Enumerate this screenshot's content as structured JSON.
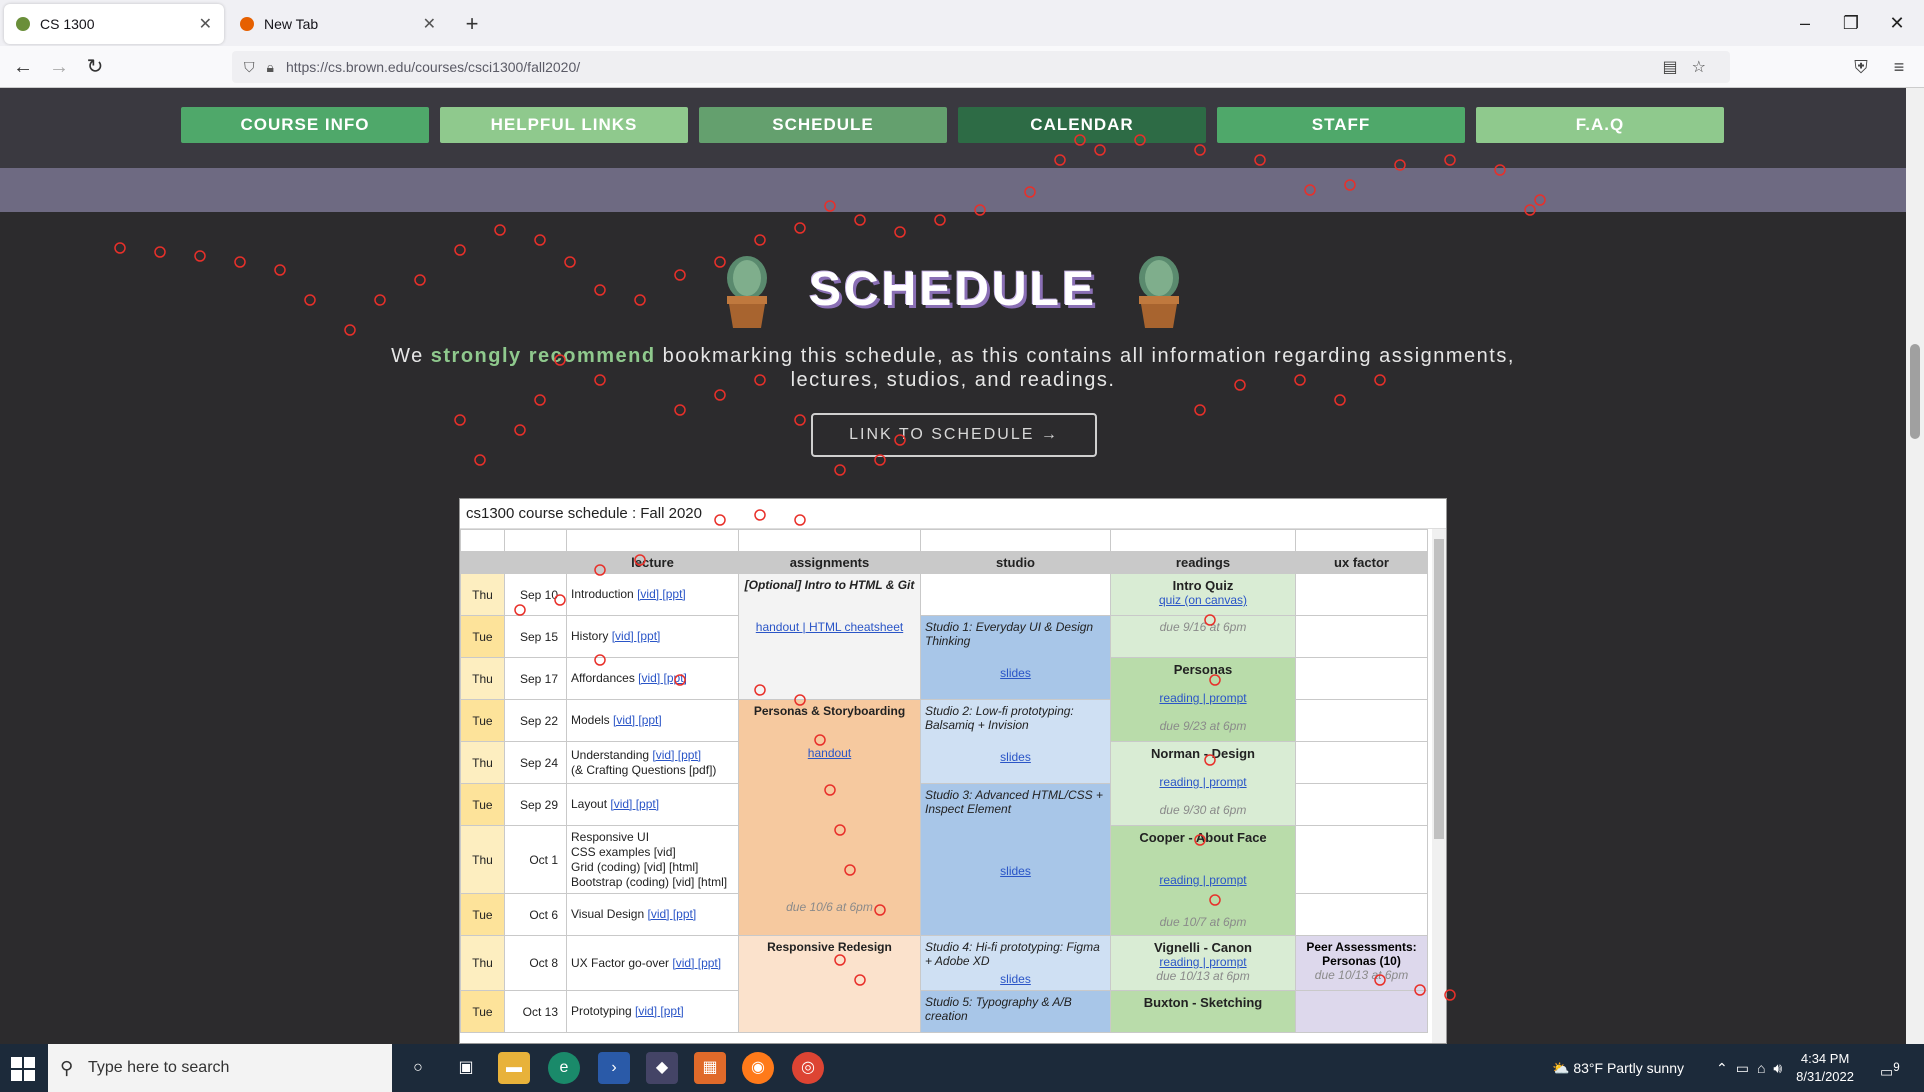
{
  "browser": {
    "tabs": [
      {
        "title": "CS 1300",
        "active": true
      },
      {
        "title": "New Tab",
        "active": false
      }
    ],
    "url": "https://cs.brown.edu/courses/csci1300/fall2020/"
  },
  "site": {
    "nav": [
      "COURSE INFO",
      "HELPFUL LINKS",
      "SCHEDULE",
      "CALENDAR",
      "STAFF",
      "F.A.Q"
    ],
    "nav_colors": [
      "#4fa86a",
      "#8fc98d",
      "#64a06e",
      "#2d6b45",
      "#4fa86a",
      "#8fc98d"
    ],
    "heading": "SCHEDULE",
    "intro_pre": "We ",
    "intro_highlight": "strongly recommend",
    "intro_post": " bookmarking this schedule, as this contains all information regarding assignments, lectures, studios, and readings.",
    "link_button": "LINK TO SCHEDULE →"
  },
  "sheet": {
    "title": "cs1300 course schedule : Fall 2020",
    "headers": [
      "lecture",
      "assignments",
      "studio",
      "readings",
      "ux factor"
    ],
    "rows": [
      {
        "day": "Thu",
        "date": "Sep 10",
        "lecture": "Introduction",
        "links": "[vid] [ppt]"
      },
      {
        "day": "Tue",
        "date": "Sep 15",
        "lecture": "History",
        "links": "[vid] [ppt]"
      },
      {
        "day": "Thu",
        "date": "Sep 17",
        "lecture": "Affordances",
        "links": "[vid] [ppt]"
      },
      {
        "day": "Tue",
        "date": "Sep 22",
        "lecture": "Models",
        "links": "[vid] [ppt]"
      },
      {
        "day": "Thu",
        "date": "Sep 24",
        "lecture": "Understanding",
        "links": "[vid] [ppt]",
        "extra": "(& Crafting Questions [pdf])"
      },
      {
        "day": "Tue",
        "date": "Sep 29",
        "lecture": "Layout",
        "links": "[vid] [ppt]"
      },
      {
        "day": "Thu",
        "date": "Oct 1",
        "lecture": "Responsive UI",
        "sub": [
          "CSS examples [vid]",
          "Grid (coding) [vid] [html]",
          "Bootstrap (coding) [vid] [html]"
        ]
      },
      {
        "day": "Tue",
        "date": "Oct 6",
        "lecture": "Visual Design",
        "links": "[vid] [ppt]"
      },
      {
        "day": "Thu",
        "date": "Oct 8",
        "lecture": "UX Factor go-over",
        "links": "[vid] [ppt]"
      },
      {
        "day": "Tue",
        "date": "Oct 13",
        "lecture": "Prototyping",
        "links": "[vid] [ppt]"
      }
    ],
    "assignments": [
      {
        "title": "[Optional] Intro to HTML & Git",
        "links": "handout | HTML cheatsheet"
      },
      {
        "title": "Personas & Storyboarding",
        "links": "handout",
        "due": "due 10/6 at 6pm"
      },
      {
        "title": "Responsive Redesign"
      }
    ],
    "studios": [
      {
        "title": "Studio 1: Everyday UI & Design Thinking",
        "link": "slides"
      },
      {
        "title": "Studio 2: Low-fi prototyping: Balsamiq + Invision",
        "link": "slides"
      },
      {
        "title": "Studio 3: Advanced HTML/CSS + Inspect Element",
        "link": "slides"
      },
      {
        "title": "Studio 4: Hi-fi prototyping: Figma + Adobe XD",
        "link": "slides"
      },
      {
        "title": "Studio 5: Typography & A/B creation"
      }
    ],
    "readings": [
      {
        "title": "Intro Quiz",
        "link": "quiz (on canvas)",
        "due": "due 9/16 at 6pm"
      },
      {
        "title": "Personas",
        "link": "reading | prompt",
        "due": "due 9/23 at 6pm"
      },
      {
        "title": "Norman - Design",
        "link": "reading | prompt",
        "due": "due 9/30 at 6pm"
      },
      {
        "title": "Cooper - About Face",
        "link": "reading | prompt",
        "due": "due 10/7 at 6pm"
      },
      {
        "title": "Vignelli - Canon",
        "link": "reading | prompt",
        "due": "due 10/13 at 6pm"
      },
      {
        "title": "Buxton - Sketching"
      }
    ],
    "ux": {
      "title": "Peer Assessments: Personas (10)",
      "due": "due 10/13 at 6pm"
    }
  },
  "taskbar": {
    "search_placeholder": "Type here to search",
    "weather": "83°F  Partly sunny",
    "time": "4:34 PM",
    "date": "8/31/2022",
    "notifications": "9"
  }
}
